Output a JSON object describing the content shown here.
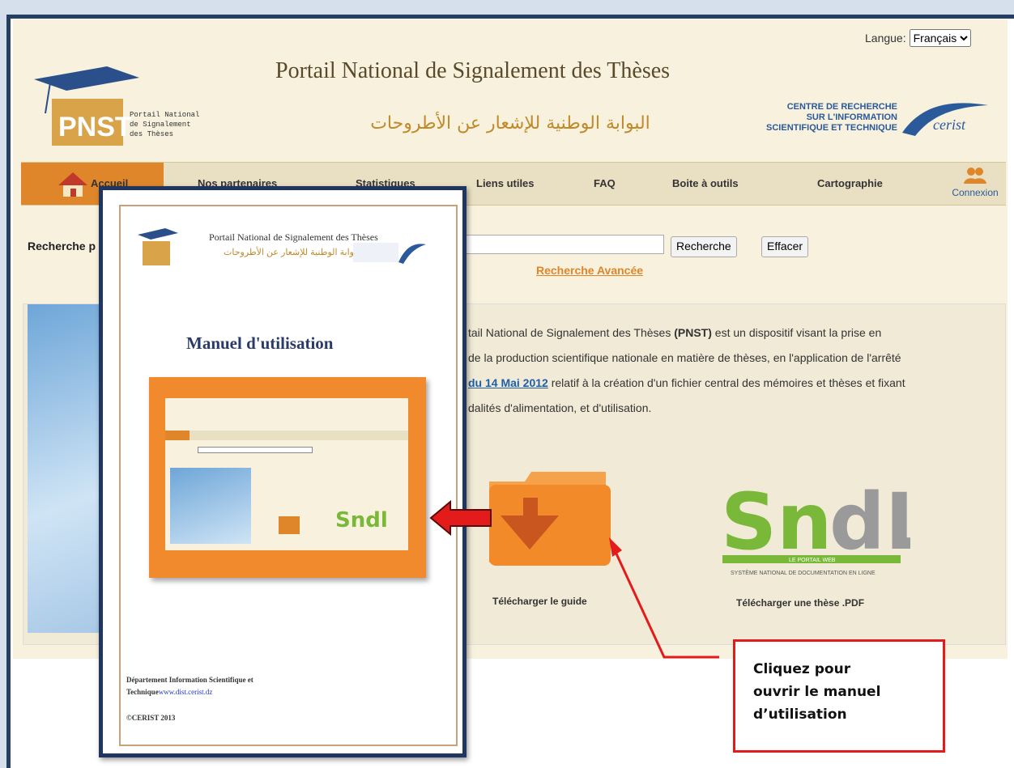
{
  "header": {
    "language_label": "Langue:",
    "language_selected": "Français",
    "logo_text_line1": "Portail National",
    "logo_text_line2": "de Signalement",
    "logo_text_line3": "des Thèses",
    "logo_abbr": "PNST",
    "title_fr": "Portail National de Signalement des Thèses",
    "title_ar": "البوابة الوطنية للإشعار عن الأطروحات",
    "cerist_line1": "CENTRE DE RECHERCHE",
    "cerist_line2": "SUR L'INFORMATION",
    "cerist_line3": "SCIENTIFIQUE ET TECHNIQUE",
    "cerist_brand": "cerist"
  },
  "nav": {
    "items": [
      "Accueil",
      "Nos partenaires",
      "Statistiques",
      "Liens utiles",
      "FAQ",
      "Boite à outils",
      "Cartographie",
      "Connexion"
    ]
  },
  "search": {
    "label": "Recherche p",
    "search_button": "Recherche",
    "clear_button": "Effacer",
    "advanced_link": "Recherche Avancée"
  },
  "content": {
    "para_1": "tail National de Signalement des Thèses ",
    "para_bold": "(PNST)",
    "para_2": " est un dispositif visant la prise en",
    "para_line2": "de la production scientifique nationale en matière de thèses, en l'application de l'arrêté",
    "para_link": "du 14 Mai 2012",
    "para_line3": " relatif à la création d'un fichier central des mémoires et thèses et fixant",
    "para_line4": "dalités d'alimentation, et d'utilisation.",
    "download_guide_label": "Télécharger le guide",
    "download_thesis_label": "Télécharger une thèse .PDF",
    "sndl_tagline": "LE PORTAIL WEB",
    "sndl_sub": "SYSTÈME NATIONAL DE DOCUMENTATION EN LIGNE"
  },
  "manual": {
    "header_title": "Portail National de Signalement des Thèses",
    "header_title_ar": "البوابة الوطنية للإشعار عن الأطروحات",
    "heading": "Manuel d'utilisation",
    "footer_line1": "Département Information Scientifique et",
    "footer_line2_prefix": "Technique",
    "footer_link": "www.dist.cerist.dz",
    "copyright": "©CERIST 2013"
  },
  "callout": {
    "line1": "Cliquez pour",
    "line2": "ouvrir le manuel",
    "line3": "d’utilisation"
  },
  "colors": {
    "accent_orange": "#e0862a",
    "frame_blue": "#1f3760",
    "arrow_red": "#e31b1b",
    "sndl_green": "#7ab83a"
  }
}
